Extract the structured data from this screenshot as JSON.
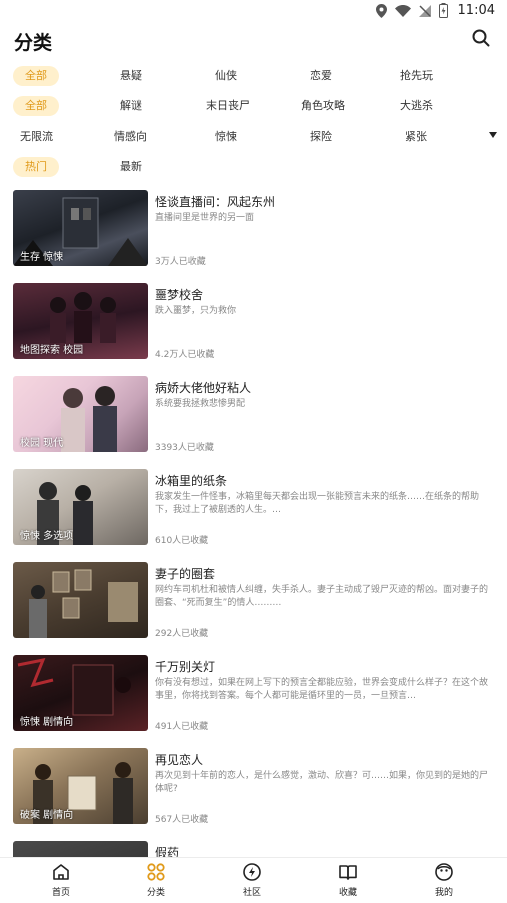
{
  "status": {
    "time": "11:04"
  },
  "header": {
    "title": "分类"
  },
  "filters": {
    "row1": [
      "全部",
      "悬疑",
      "仙侠",
      "恋爱",
      "抢先玩"
    ],
    "row2": [
      "全部",
      "解谜",
      "末日丧尸",
      "角色攻略",
      "大逃杀"
    ],
    "row3": [
      "无限流",
      "情感向",
      "惊悚",
      "探险",
      "紧张"
    ],
    "row4": [
      "热门",
      "最新"
    ]
  },
  "accent_color": "#e09a1a",
  "accent_bg": "#fff0cc",
  "items": [
    {
      "title": "怪谈直播间：风起东州",
      "desc": "直播间里是世界的另一面",
      "count": "3万人已收藏",
      "tags": "生存  惊悚"
    },
    {
      "title": "噩梦校舍",
      "desc": "跌入噩梦，只为救你",
      "count": "4.2万人已收藏",
      "tags": "地图探索  校园"
    },
    {
      "title": "病娇大佬他好粘人",
      "desc": "系统要我拯救悲惨男配",
      "count": "3393人已收藏",
      "tags": "校园  现代"
    },
    {
      "title": "冰箱里的纸条",
      "desc": "我家发生一件怪事，冰箱里每天都会出现一张能预言未来的纸条……在纸条的帮助下，我过上了被剧透的人生。…",
      "count": "610人已收藏",
      "tags": "惊悚  多选项"
    },
    {
      "title": "妻子的圈套",
      "desc": "网约车司机杜和被情人纠缠，失手杀人。妻子主动成了毁尸灭迹的帮凶。面对妻子的圈套、“死而复生”的情人………",
      "count": "292人已收藏",
      "tags": ""
    },
    {
      "title": "千万别关灯",
      "desc": "你有没有想过，如果在网上写下的预言全都能应验，世界会变成什么样子？在这个故事里，你将找到答案。每个人都可能是循环里的一员，一旦预言…",
      "count": "491人已收藏",
      "tags": "惊悚  剧情向"
    },
    {
      "title": "再见恋人",
      "desc": "再次见到十年前的恋人，是什么感觉，激动、欣喜？可……如果，你见到的是她的尸体呢?",
      "count": "567人已收藏",
      "tags": "破案  剧情向"
    },
    {
      "title": "假药",
      "desc": "",
      "count": "",
      "tags": ""
    }
  ],
  "nav": [
    "首页",
    "分类",
    "社区",
    "收藏",
    "我的"
  ]
}
